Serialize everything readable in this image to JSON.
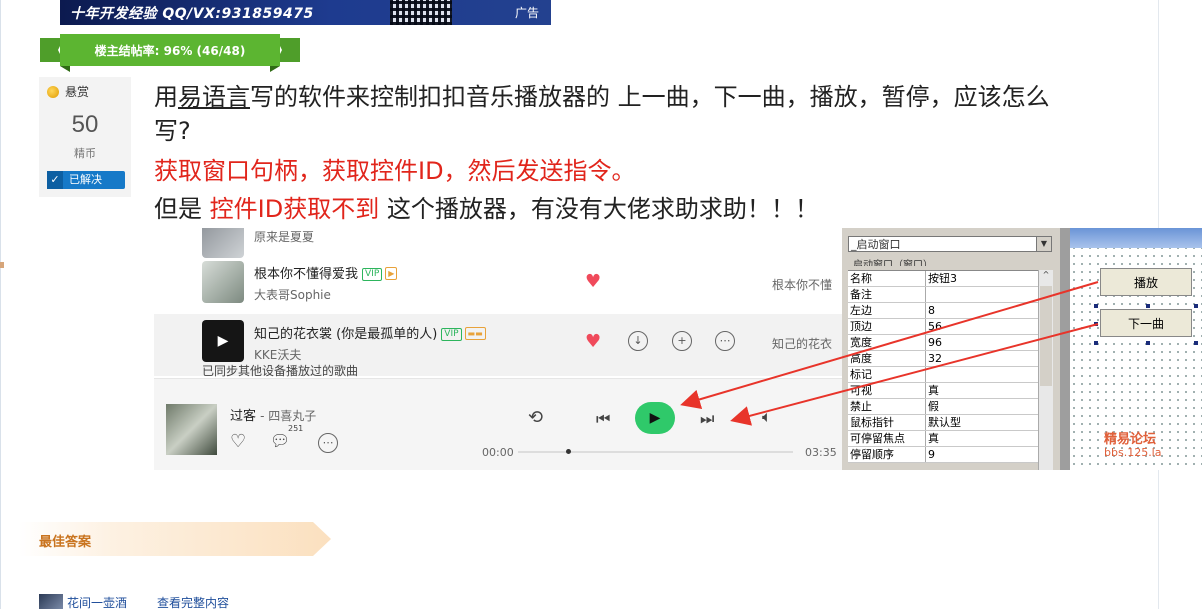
{
  "ad": {
    "text": "十年开发经验 QQ/VX:931859475",
    "tag": "广告"
  },
  "ribbon": {
    "text": "楼主结帖率: 96% (46/48)"
  },
  "bounty": {
    "label": "悬赏",
    "amount": "50",
    "unit": "精币",
    "status": "已解决"
  },
  "question": {
    "line1_pre": "用",
    "line1_link": "易语言",
    "line1_post": "写的软件来控制扣扣音乐播放器的 上一曲，下一曲，播放，暂停，应该怎么",
    "line2": "写?",
    "line3": "获取窗口句柄，获取控件ID，然后发送指令。",
    "line4_pre": "但是 ",
    "line4_red": "控件ID获取不到",
    "line4_post": " 这个播放器，有没有大佬求助求助！！！"
  },
  "player": {
    "rows": [
      {
        "song": "",
        "artist": "原来是夏夏",
        "album": ""
      },
      {
        "song": "根本你不懂得爱我",
        "artist": "大表哥Sophie",
        "album": "根本你不懂"
      },
      {
        "song": "知己的花衣裳 (你是最孤单的人)",
        "artist": "KKE沃夫",
        "album": "知己的花衣"
      }
    ],
    "vip_label": "VIP",
    "sync_text": "已同步其他设备播放过的歌曲",
    "now_playing_title": "过客",
    "now_playing_artist": "- 四喜丸子",
    "comment_count": "251",
    "time_current": "00:00",
    "time_total": "03:35"
  },
  "ide": {
    "combo": "_启动窗口",
    "sub": "_启动窗口（窗口）",
    "props": [
      {
        "k": "名称",
        "v": "按钮3"
      },
      {
        "k": "备注",
        "v": ""
      },
      {
        "k": "左边",
        "v": "8"
      },
      {
        "k": "顶边",
        "v": "56"
      },
      {
        "k": "宽度",
        "v": "96"
      },
      {
        "k": "高度",
        "v": "32"
      },
      {
        "k": "标记",
        "v": ""
      },
      {
        "k": "可视",
        "v": "真"
      },
      {
        "k": "禁止",
        "v": "假"
      },
      {
        "k": "鼠标指针",
        "v": "默认型"
      },
      {
        "k": "可停留焦点",
        "v": "真"
      },
      {
        "k": "停留顺序",
        "v": "9"
      }
    ]
  },
  "canvas": {
    "btn_play": "播放",
    "btn_next": "下一曲",
    "watermark": "精易论坛",
    "watermark_url": "bbs.125.la"
  },
  "best_answer": {
    "label": "最佳答案",
    "user": "花间一壶酒",
    "view_all": "查看完整内容"
  },
  "colors": {
    "accent_red": "#e1251b",
    "ribbon_green": "#5cb531",
    "play_green": "#2fc96a",
    "solved_blue": "#1679c8",
    "best_orange": "#c9741f"
  }
}
